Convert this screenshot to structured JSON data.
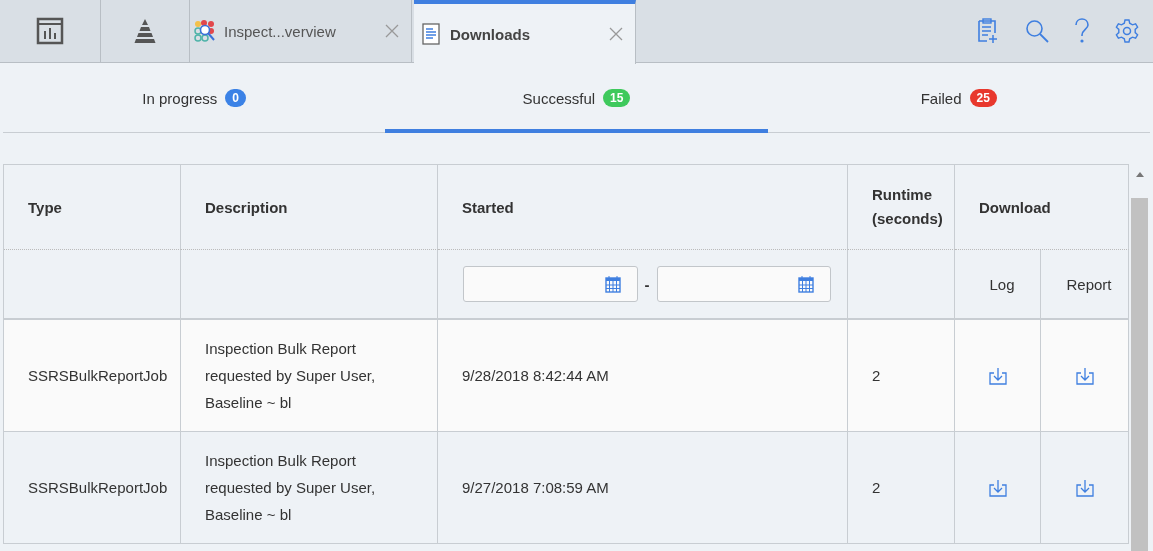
{
  "app_tabs": [
    {
      "kind": "dashboard",
      "selected": false
    },
    {
      "kind": "pyramid",
      "selected": false
    },
    {
      "kind": "app",
      "label": "Inspect...verview",
      "selected": false
    },
    {
      "kind": "document",
      "label": "Downloads",
      "selected": true
    }
  ],
  "status_tabs": [
    {
      "label": "In progress",
      "count": "0",
      "color": "#3b82e6",
      "selected": false
    },
    {
      "label": "Successful",
      "count": "15",
      "color": "#3ec95c",
      "selected": true
    },
    {
      "label": "Failed",
      "count": "25",
      "color": "#e8382d",
      "selected": false
    }
  ],
  "table": {
    "columns": [
      "Type",
      "Description",
      "Started",
      "Runtime (seconds)",
      "Download"
    ],
    "subcolumns": [
      "Log",
      "Report"
    ],
    "started_filter": {
      "separator": "-"
    },
    "rows": [
      {
        "type": "SSRSBulkReportJob",
        "description": "Inspection Bulk Report requested by Super User, Baseline ~ bl",
        "started": "9/28/2018 8:42:44 AM",
        "runtime": "2"
      },
      {
        "type": "SSRSBulkReportJob",
        "description": "Inspection Bulk Report requested by Super User, Baseline ~ bl",
        "started": "9/27/2018 7:08:59 AM",
        "runtime": "2"
      }
    ]
  }
}
